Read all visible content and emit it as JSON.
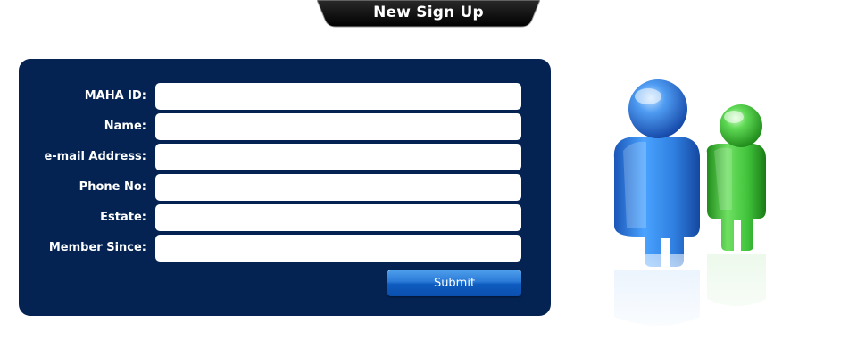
{
  "header": {
    "title": "New Sign Up"
  },
  "form": {
    "fields": [
      {
        "label": "MAHA ID:",
        "value": ""
      },
      {
        "label": "Name:",
        "value": ""
      },
      {
        "label": "e-mail Address:",
        "value": ""
      },
      {
        "label": "Phone No:",
        "value": ""
      },
      {
        "label": "Estate:",
        "value": ""
      },
      {
        "label": "Member Since:",
        "value": ""
      }
    ],
    "submit_label": "Submit"
  },
  "colors": {
    "panel": "#042353",
    "tab": "#0a0a0a",
    "button": "#1f6fd0",
    "user_blue": "#2f7fe0",
    "user_green": "#3fc23a"
  },
  "icons": {
    "illustration": "users-icon"
  }
}
